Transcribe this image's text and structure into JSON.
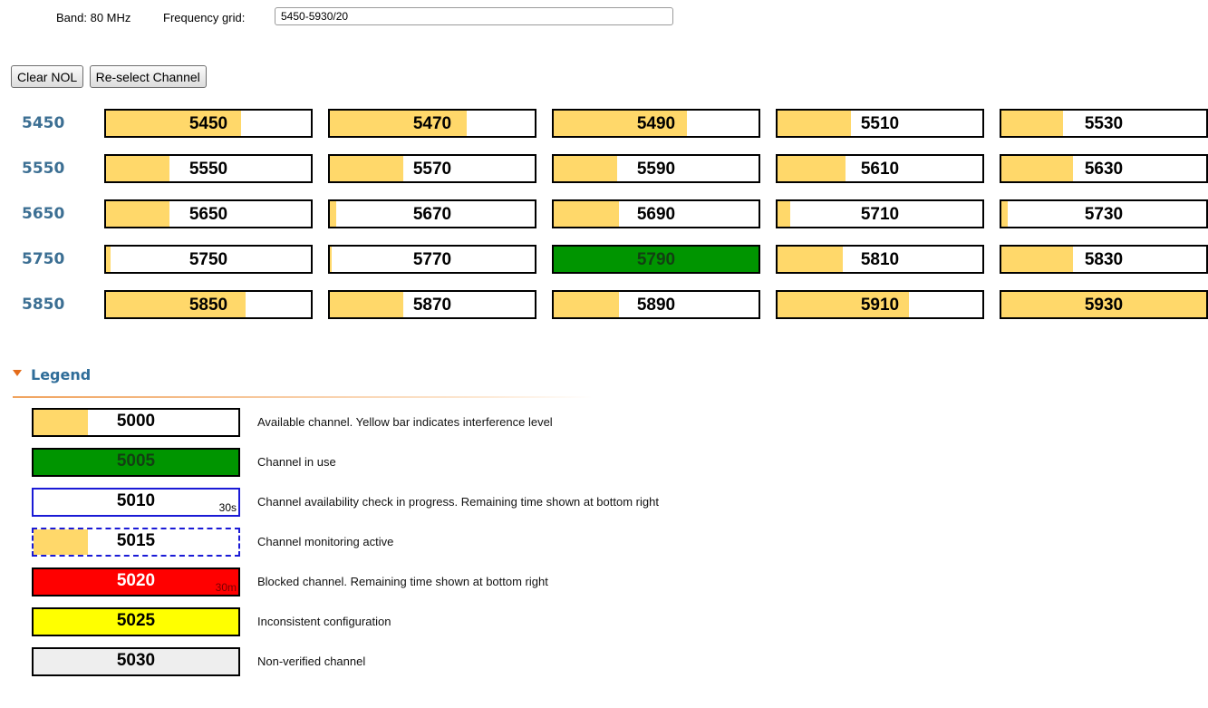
{
  "header": {
    "band_label": "Band:",
    "band_value": "80 MHz",
    "frequency_grid_label": "Frequency grid:",
    "frequency_grid_value": "5450-5930/20"
  },
  "buttons": {
    "clear_nol": "Clear NOL",
    "reselect_channel": "Re-select Channel"
  },
  "rows": [
    {
      "label": "5450",
      "channels": [
        {
          "freq": "5450",
          "status": "available",
          "interference": 0.66
        },
        {
          "freq": "5470",
          "status": "available",
          "interference": 0.67
        },
        {
          "freq": "5490",
          "status": "available",
          "interference": 0.65
        },
        {
          "freq": "5510",
          "status": "available",
          "interference": 0.36
        },
        {
          "freq": "5530",
          "status": "available",
          "interference": 0.3
        }
      ]
    },
    {
      "label": "5550",
      "channels": [
        {
          "freq": "5550",
          "status": "available",
          "interference": 0.31
        },
        {
          "freq": "5570",
          "status": "available",
          "interference": 0.36
        },
        {
          "freq": "5590",
          "status": "available",
          "interference": 0.31
        },
        {
          "freq": "5610",
          "status": "available",
          "interference": 0.33
        },
        {
          "freq": "5630",
          "status": "available",
          "interference": 0.35
        }
      ]
    },
    {
      "label": "5650",
      "channels": [
        {
          "freq": "5650",
          "status": "available",
          "interference": 0.31
        },
        {
          "freq": "5670",
          "status": "available",
          "interference": 0.03
        },
        {
          "freq": "5690",
          "status": "available",
          "interference": 0.32
        },
        {
          "freq": "5710",
          "status": "available",
          "interference": 0.06
        },
        {
          "freq": "5730",
          "status": "available",
          "interference": 0.03
        }
      ]
    },
    {
      "label": "5750",
      "channels": [
        {
          "freq": "5750",
          "status": "available",
          "interference": 0.02
        },
        {
          "freq": "5770",
          "status": "available",
          "interference": 0.01
        },
        {
          "freq": "5790",
          "status": "in_use",
          "interference": 0
        },
        {
          "freq": "5810",
          "status": "available",
          "interference": 0.32
        },
        {
          "freq": "5830",
          "status": "available",
          "interference": 0.35
        }
      ]
    },
    {
      "label": "5850",
      "channels": [
        {
          "freq": "5850",
          "status": "available",
          "interference": 0.68
        },
        {
          "freq": "5870",
          "status": "available",
          "interference": 0.36
        },
        {
          "freq": "5890",
          "status": "available",
          "interference": 0.32
        },
        {
          "freq": "5910",
          "status": "available",
          "interference": 0.64
        },
        {
          "freq": "5930",
          "status": "available",
          "interference": 1.0
        }
      ]
    }
  ],
  "legend": {
    "title": "Legend",
    "items": [
      {
        "freq": "5000",
        "kind": "available",
        "description": "Available channel. Yellow bar indicates interference level",
        "time": ""
      },
      {
        "freq": "5005",
        "kind": "inuse",
        "description": "Channel in use",
        "time": ""
      },
      {
        "freq": "5010",
        "kind": "check",
        "description": "Channel availability check in progress. Remaining time shown at bottom right",
        "time": "30s"
      },
      {
        "freq": "5015",
        "kind": "monitor",
        "description": "Channel monitoring active",
        "time": ""
      },
      {
        "freq": "5020",
        "kind": "blocked",
        "description": "Blocked channel. Remaining time shown at bottom right",
        "time": "30m"
      },
      {
        "freq": "5025",
        "kind": "inconsistent",
        "description": "Inconsistent configuration",
        "time": ""
      },
      {
        "freq": "5030",
        "kind": "nonverified",
        "description": "Non-verified channel",
        "time": ""
      }
    ]
  },
  "colors": {
    "interference_bar": "#ffd86a",
    "in_use": "#009500",
    "row_label": "#3c6f93",
    "legend_title": "#2f6d99",
    "legend_arrow": "#e46c1a",
    "blocked": "#ff0000",
    "inconsistent": "#ffff00",
    "non_verified": "#eeeeee",
    "check_border": "#1a1ad6"
  }
}
